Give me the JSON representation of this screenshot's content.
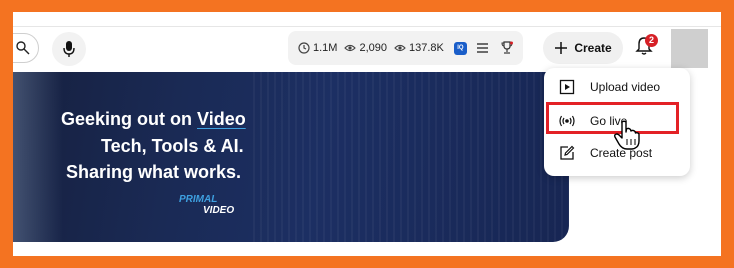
{
  "header": {
    "stats": [
      {
        "icon": "subscribers-icon",
        "value": "1.1M"
      },
      {
        "icon": "eye-icon",
        "value": "2,090"
      },
      {
        "icon": "eye-icon",
        "value": "137.8K"
      }
    ],
    "extension_badge": "IQ",
    "create_label": "Create",
    "notification_count": "2"
  },
  "banner": {
    "line1_prefix": "Geeking out on ",
    "line1_highlight": "Video",
    "line2": "Tech, Tools & AI.",
    "line3": "Sharing what works.",
    "logo_top": "PRIMAL",
    "logo_bottom": "VIDEO"
  },
  "create_menu": {
    "items": [
      {
        "label": "Upload video",
        "icon": "upload-video-icon"
      },
      {
        "label": "Go live",
        "icon": "live-broadcast-icon"
      },
      {
        "label": "Create post",
        "icon": "edit-post-icon"
      }
    ]
  },
  "colors": {
    "frame_border": "#f47321",
    "highlight": "#e32126",
    "badge": "#d62027",
    "accent_blue": "#3ea0e0"
  }
}
